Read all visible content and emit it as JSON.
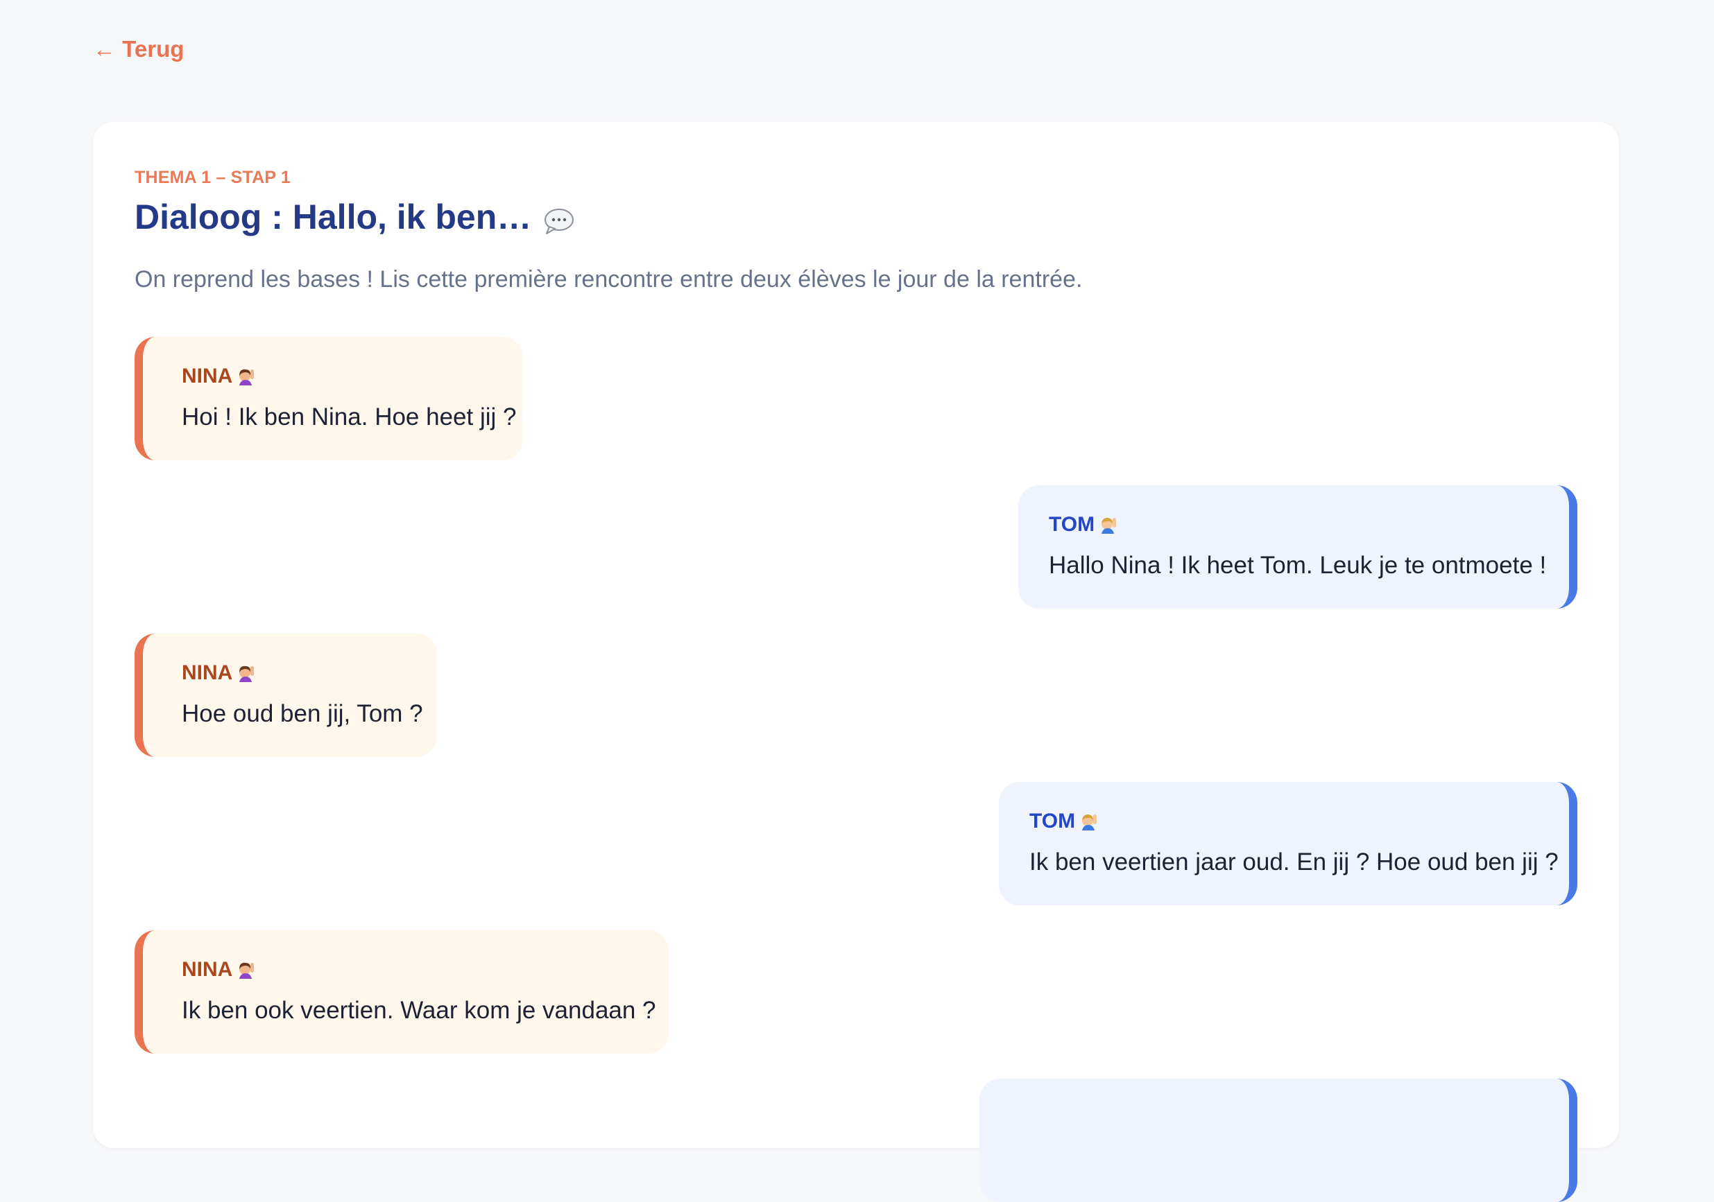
{
  "nav": {
    "back_label": "← Terug"
  },
  "lesson": {
    "eyebrow": "THEMA 1 – STAP 1",
    "title": "Dialoog : Hallo, ik ben…",
    "title_icon": "speech-bubble-icon",
    "intro": "On reprend les bases ! Lis cette première rencontre entre deux élèves le jour de la rentrée."
  },
  "dialogue": [
    {
      "speaker": "NINA",
      "avatar": "girl-raising-hand-icon",
      "text": "Hoi ! Ik ben Nina. Hoe heet jij ?"
    },
    {
      "speaker": "TOM",
      "avatar": "boy-raising-hand-icon",
      "text": "Hallo Nina ! Ik heet Tom. Leuk je te ontmoete !"
    },
    {
      "speaker": "NINA",
      "avatar": "girl-raising-hand-icon",
      "text": "Hoe oud ben jij, Tom ?"
    },
    {
      "speaker": "TOM",
      "avatar": "boy-raising-hand-icon",
      "text": "Ik ben veertien jaar oud. En jij ? Hoe oud ben jij ?"
    },
    {
      "speaker": "NINA",
      "avatar": "girl-raising-hand-icon",
      "text": "Ik ben ook veertien. Waar kom je vandaan ?"
    },
    {
      "speaker": "",
      "avatar": "",
      "text": ""
    }
  ],
  "colors": {
    "accent_orange": "#ea7452",
    "title_navy": "#243a86",
    "nina_bubble": "#fff6ec",
    "tom_bubble": "#eef3fd",
    "tom_accent": "#4a7ae6"
  }
}
